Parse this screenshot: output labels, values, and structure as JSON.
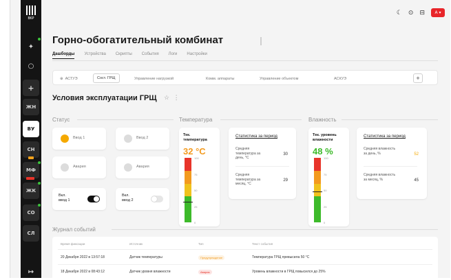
{
  "app": {
    "logo_text": "ВКР",
    "colors": {
      "accent": "#f5a900",
      "brand_red": "#e8252a",
      "gauge_green": "#3dba2a",
      "gauge_yellow": "#f0c21c",
      "gauge_orange": "#f39a1e",
      "gauge_red": "#e8342a"
    }
  },
  "sidebar": {
    "items": [
      {
        "label": "",
        "icon": "sparkle-icon"
      },
      {
        "label": "",
        "icon": "search-icon"
      },
      {
        "label": "",
        "icon": "plus-icon"
      },
      {
        "label": "ЖН"
      },
      {
        "label": "ВУ"
      },
      {
        "label": "СН"
      },
      {
        "label": "МФ"
      },
      {
        "label": "ЖК"
      },
      {
        "label": "СО"
      },
      {
        "label": "СЛ"
      },
      {
        "label": "",
        "icon": "logout-icon"
      }
    ]
  },
  "topbar": {
    "icons": [
      "moon-icon",
      "help-icon",
      "database-icon"
    ],
    "avatar_label": "А"
  },
  "header": {
    "title": "Горно-обогатительный комбинат",
    "nav": [
      "Дашборды",
      "Устройства",
      "Скрипты",
      "События",
      "Логи",
      "Настройки"
    ]
  },
  "tabs": [
    "АСТУЭ",
    "Сост. ГРЩ",
    "Управление нагрузкой",
    "Комм. аппараты",
    "Управление объектом",
    "АСКУЭ"
  ],
  "dashboard": {
    "title": "Условия эксплуатации ГРЩ"
  },
  "status": {
    "section_title": "Статус",
    "cards": [
      {
        "label": "Ввод 1",
        "on": true
      },
      {
        "label": "Ввод 2",
        "on": false
      },
      {
        "label": "Авария",
        "on": false
      },
      {
        "label": "Авария",
        "on": false
      }
    ],
    "toggles": [
      {
        "label_line1": "Вкл.",
        "label_line2": "ввод 1",
        "on": true
      },
      {
        "label_line1": "Вкл.",
        "label_line2": "ввод 2",
        "on": false
      }
    ]
  },
  "temperature": {
    "section_title": "Температура",
    "gauge_title_1": "Тек.",
    "gauge_title_2": "температура",
    "value": "32 °C",
    "level": 0.32,
    "ticks": [
      "100",
      "75",
      "50",
      "25",
      "0"
    ],
    "stats_link": "Статистика за период",
    "stats": [
      {
        "label": "Средняя температура за день, °С",
        "value": "30"
      },
      {
        "label": "Средняя температура за месяц, °С",
        "value": "29"
      }
    ]
  },
  "humidity": {
    "section_title": "Влажность",
    "gauge_title_1": "Тек. уровень",
    "gauge_title_2": "влажности",
    "value": "48 %",
    "level": 0.48,
    "ticks": [
      "100",
      "75",
      "50",
      "25",
      "0"
    ],
    "stats_link": "Статистика за период",
    "stats": [
      {
        "label": "Средняя влажность за день, %",
        "value": "52"
      },
      {
        "label": "Средняя влажность за месяц, %",
        "value": "45"
      }
    ]
  },
  "journal": {
    "section_title": "Журнал событий",
    "columns": [
      "Время фиксации",
      "Источник",
      "Тип",
      "Текст события"
    ],
    "rows": [
      {
        "time": "20 Декабря 2022 в 13:57:18",
        "source": "Датчик температуры",
        "type": "Предупреждение",
        "type_color": "#f39a1e",
        "text": "Температура ГРЩ превысила 50 °С"
      },
      {
        "time": "18 Декабря 2022 в 08:43:12",
        "source": "Датчик уровня влажности",
        "type": "Авария",
        "type_color": "#e8342a",
        "text": "Уровень влажности в ГРЩ повысился до 25%"
      }
    ]
  }
}
